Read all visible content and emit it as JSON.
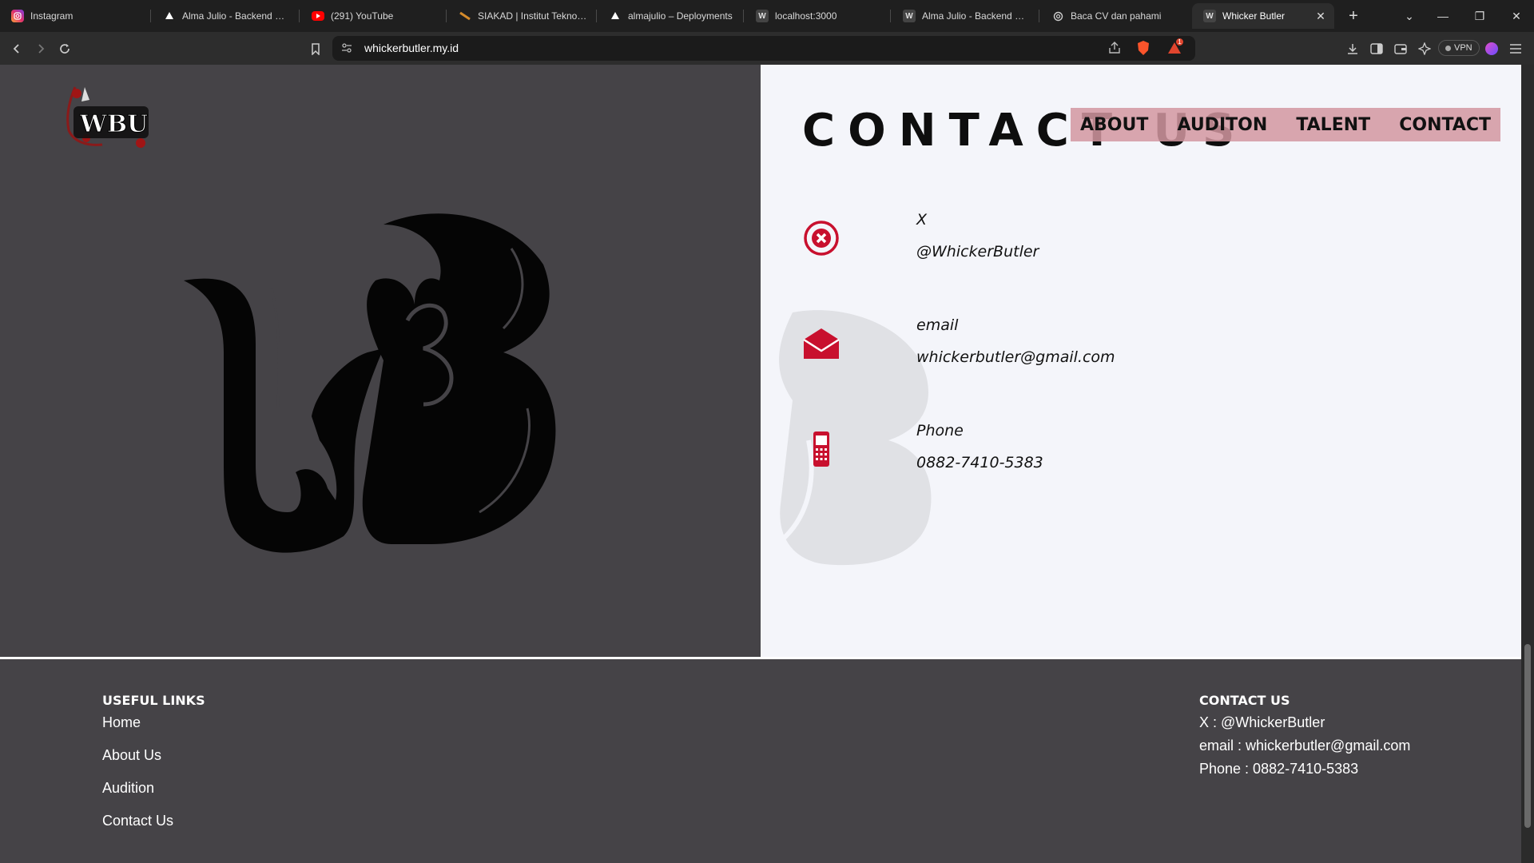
{
  "browser": {
    "tabs": [
      {
        "title": "Instagram",
        "icon": "instagram-icon",
        "color": "#e1306c"
      },
      {
        "title": "Alma Julio - Backend Dev",
        "icon": "vercel-icon",
        "color": "#ffffff"
      },
      {
        "title": "(291) YouTube",
        "icon": "youtube-icon",
        "color": "#ff0000"
      },
      {
        "title": "SIAKAD | Institut Teknolog",
        "icon": "siakad-icon",
        "color": "#d48a2a"
      },
      {
        "title": "almajulio – Deployments",
        "icon": "vercel-icon",
        "color": "#ffffff"
      },
      {
        "title": "localhost:3000",
        "icon": "wbu-icon",
        "color": "#888888"
      },
      {
        "title": "Alma Julio - Backend Dev",
        "icon": "wbu-icon",
        "color": "#888888"
      },
      {
        "title": "Baca CV dan pahami",
        "icon": "openai-icon",
        "color": "#cccccc"
      },
      {
        "title": "Whicker Butler",
        "icon": "wbu-icon",
        "color": "#888888"
      }
    ],
    "url": "whickerbutler.my.id",
    "vpn_label": "VPN",
    "notification_count": "1"
  },
  "hero": {
    "logo_alt": "WBU",
    "emblem_alt": "WB"
  },
  "contact": {
    "title": "CONTACT US",
    "items": [
      {
        "label": "X",
        "value": "@WhickerButler",
        "icon": "x-circle-icon"
      },
      {
        "label": "email",
        "value": "whickerbutler@gmail.com",
        "icon": "envelope-icon"
      },
      {
        "label": "Phone",
        "value": "0882-7410-5383",
        "icon": "mobile-phone-icon"
      }
    ],
    "accent": "#c8102e"
  },
  "nav": {
    "items": [
      "ABOUT",
      "AUDITON",
      "TALENT",
      "CONTACT"
    ]
  },
  "footer": {
    "useful_links_title": "USEFUL LINKS",
    "links": [
      "Home",
      "About Us",
      "Audition",
      "Contact Us"
    ],
    "contact_title": "CONTACT US",
    "contact_lines": [
      "X : @WhickerButler",
      "email : whickerbutler@gmail.com",
      "Phone : 0882-7410-5383"
    ]
  }
}
